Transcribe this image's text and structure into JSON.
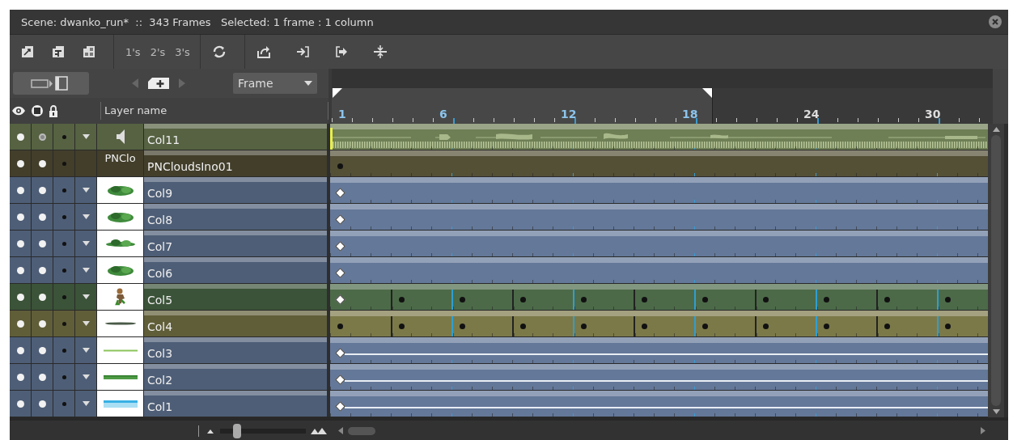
{
  "window": {
    "title": "Scene: dwanko_run*  ::  343 Frames   Selected: 1 frame : 1 column"
  },
  "toolbar": {
    "exposure_buttons": [
      "1's",
      "2's",
      "3's"
    ]
  },
  "controls": {
    "view_mode": "Frame"
  },
  "header": {
    "name_column": "Layer name"
  },
  "ruler": {
    "labels": [
      "1",
      "6",
      "12",
      "18",
      "24",
      "30"
    ]
  },
  "layers": [
    {
      "name": "Col11",
      "kind": "sound",
      "color": "#6e7e55",
      "visible": true,
      "outline": false,
      "expanded": true,
      "track": {
        "kind": "wave"
      }
    },
    {
      "name": "PNCloudsIno01",
      "kind": "text",
      "thumb": "PNClo",
      "color": "#545036",
      "visible": true,
      "outline": true,
      "expanded": false,
      "track": {
        "kind": "plain",
        "keyframe": false
      }
    },
    {
      "name": "Col9",
      "kind": "bush",
      "color": "#647899",
      "visible": true,
      "outline": true,
      "expanded": true,
      "track": {
        "kind": "plain",
        "keyframe": true
      }
    },
    {
      "name": "Col8",
      "kind": "bush",
      "color": "#647899",
      "visible": true,
      "outline": true,
      "expanded": true,
      "track": {
        "kind": "plain",
        "keyframe": true
      }
    },
    {
      "name": "Col7",
      "kind": "grass",
      "color": "#647899",
      "visible": true,
      "outline": true,
      "expanded": true,
      "track": {
        "kind": "plain",
        "keyframe": true
      }
    },
    {
      "name": "Col6",
      "kind": "bush",
      "color": "#647899",
      "visible": true,
      "outline": true,
      "expanded": true,
      "track": {
        "kind": "plain",
        "keyframe": true
      }
    },
    {
      "name": "Col5",
      "kind": "figure",
      "color": "#4c6a48",
      "visible": true,
      "outline": true,
      "expanded": true,
      "track": {
        "kind": "thirds",
        "keyframe": true
      }
    },
    {
      "name": "Col4",
      "kind": "darkline",
      "color": "#7b7948",
      "visible": true,
      "outline": true,
      "expanded": true,
      "track": {
        "kind": "thirds",
        "keyframe": false
      }
    },
    {
      "name": "Col3",
      "kind": "greenline",
      "color": "#647899",
      "visible": true,
      "outline": true,
      "expanded": true,
      "track": {
        "kind": "hold",
        "keyframe": true
      }
    },
    {
      "name": "Col2",
      "kind": "grassline",
      "color": "#647899",
      "visible": true,
      "outline": true,
      "expanded": true,
      "track": {
        "kind": "hold",
        "keyframe": true
      }
    },
    {
      "name": "Col1",
      "kind": "water",
      "color": "#647899",
      "visible": true,
      "outline": true,
      "expanded": true,
      "track": {
        "kind": "hold",
        "keyframe": true
      }
    }
  ],
  "zoom_slider": {
    "level": 0.2
  }
}
